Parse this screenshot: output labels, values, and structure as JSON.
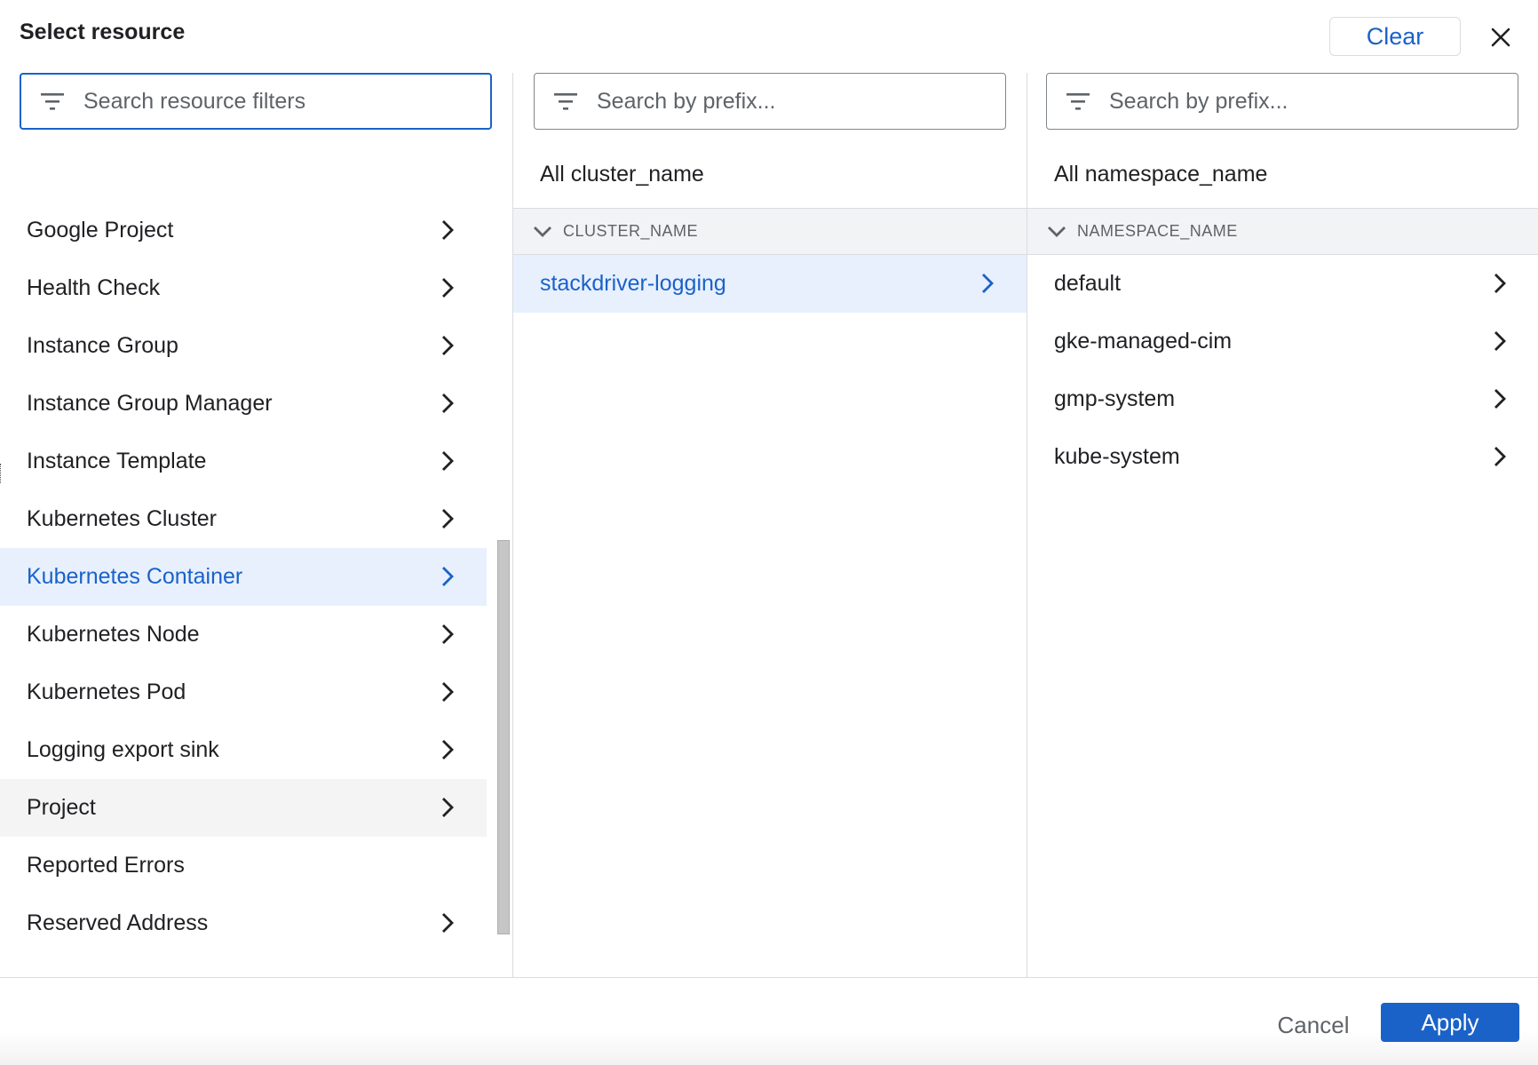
{
  "dialog": {
    "title": "Select resource",
    "clear_label": "Clear",
    "close_icon": "close-icon"
  },
  "resource_column": {
    "search_placeholder": "Search resource filters",
    "items": [
      {
        "label": "Google Project",
        "has_children": true,
        "state": "normal"
      },
      {
        "label": "Health Check",
        "has_children": true,
        "state": "normal"
      },
      {
        "label": "Instance Group",
        "has_children": true,
        "state": "normal"
      },
      {
        "label": "Instance Group Manager",
        "has_children": true,
        "state": "normal"
      },
      {
        "label": "Instance Template",
        "has_children": true,
        "state": "normal"
      },
      {
        "label": "Kubernetes Cluster",
        "has_children": true,
        "state": "normal"
      },
      {
        "label": "Kubernetes Container",
        "has_children": true,
        "state": "selected"
      },
      {
        "label": "Kubernetes Node",
        "has_children": true,
        "state": "normal"
      },
      {
        "label": "Kubernetes Pod",
        "has_children": true,
        "state": "normal"
      },
      {
        "label": "Logging export sink",
        "has_children": true,
        "state": "normal"
      },
      {
        "label": "Project",
        "has_children": true,
        "state": "hover"
      },
      {
        "label": "Reported Errors",
        "has_children": false,
        "state": "normal"
      },
      {
        "label": "Reserved Address",
        "has_children": true,
        "state": "normal"
      }
    ]
  },
  "cluster_column": {
    "search_placeholder": "Search by prefix...",
    "all_label": "All cluster_name",
    "group_header": "CLUSTER_NAME",
    "items": [
      {
        "label": "stackdriver-logging",
        "selected": true
      }
    ]
  },
  "namespace_column": {
    "search_placeholder": "Search by prefix...",
    "all_label": "All namespace_name",
    "group_header": "NAMESPACE_NAME",
    "items": [
      {
        "label": "default",
        "selected": false
      },
      {
        "label": "gke-managed-cim",
        "selected": false
      },
      {
        "label": "gmp-system",
        "selected": false
      },
      {
        "label": "kube-system",
        "selected": false
      }
    ]
  },
  "footer": {
    "cancel_label": "Cancel",
    "apply_label": "Apply"
  },
  "colors": {
    "accent": "#1a62c8",
    "selected_bg": "#e8f0fe",
    "hover_bg": "#f4f4f4",
    "header_bg": "#f1f3f4"
  }
}
